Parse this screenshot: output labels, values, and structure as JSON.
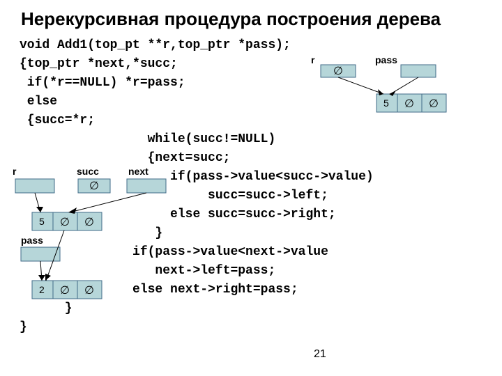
{
  "title": "Нерекурсивная процедура построения дерева",
  "code": "void Add1(top_pt **r,top_ptr *pass);\n{top_ptr *next,*succ;\n if(*r==NULL) *r=pass;\n else\n {succ=*r;\n                 while(succ!=NULL)\n                 {next=succ;\n                    if(pass->value<succ->value)\n                         succ=succ->left;\n                    else succ=succ->right;\n                  }\n               if(pass->value<next->value\n                  next->left=pass;\n               else next->right=pass;\n      }\n}",
  "page": "21",
  "top": {
    "r": "r",
    "pass": "pass",
    "val": "5",
    "null": "∅"
  },
  "bot": {
    "r": "r",
    "succ": "succ",
    "next": "next",
    "pass": "pass",
    "v1": "5",
    "v2": "2",
    "null": "∅"
  }
}
